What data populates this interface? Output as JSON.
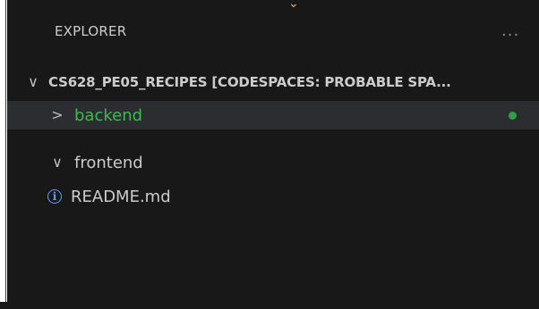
{
  "explorer": {
    "title": "EXPLORER",
    "more_icon": "...",
    "workspace": {
      "chevron": "∨",
      "label": "CS628_PE05_RECIPES [CODESPACES: PROBABLE SPA..."
    },
    "items": [
      {
        "name": "backend",
        "chevron": ">",
        "label": "backend",
        "status": "modified",
        "color": "#3fb950"
      },
      {
        "name": "frontend",
        "chevron": "∨",
        "label": "frontend"
      },
      {
        "name": "readme",
        "icon": "info-icon",
        "label": "README.md"
      }
    ]
  },
  "colors": {
    "background": "#181818",
    "selection": "#2b2d30",
    "git_added": "#3fb950",
    "info": "#5ea0ff"
  }
}
